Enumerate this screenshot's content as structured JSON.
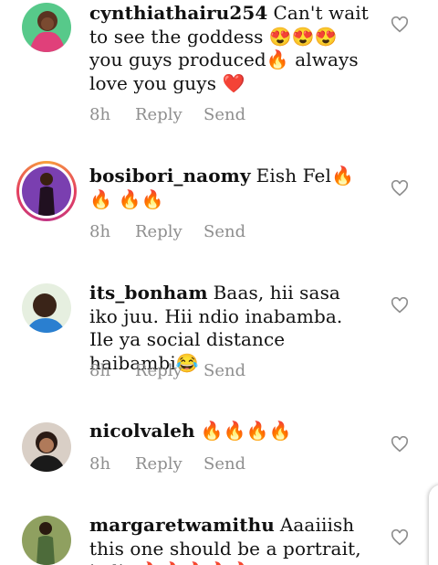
{
  "comments": [
    {
      "username": "cynthiathairu254",
      "text": "Can't wait to see the goddess 😍😍😍 you guys produced🔥 always love you guys ❤️",
      "time": "8h",
      "reply": "Reply",
      "send": "Send"
    },
    {
      "username": "bosibori_naomy",
      "text": "Eish Fel🔥🔥 🔥🔥",
      "time": "8h",
      "reply": "Reply",
      "send": "Send"
    },
    {
      "username": "its_bonham",
      "text": "Baas, hii sasa iko juu. Hii ndio inabamba. Ile ya social distance haibambi😂",
      "time": "8h",
      "reply": "Reply",
      "send": "Send"
    },
    {
      "username": "nicolvaleh",
      "text": "🔥🔥🔥🔥",
      "time": "8h",
      "reply": "Reply",
      "send": "Send"
    },
    {
      "username": "margaretwamithu",
      "text": "Aaaiiish this one should be a portrait, itslit 🔥🔥🔥🔥🔥",
      "time": "",
      "reply": "",
      "send": ""
    }
  ],
  "icons": {
    "like": "heart-outline-icon"
  },
  "colors": {
    "meta_text": "#8e8e8e",
    "story_ring": "#e4405f"
  }
}
